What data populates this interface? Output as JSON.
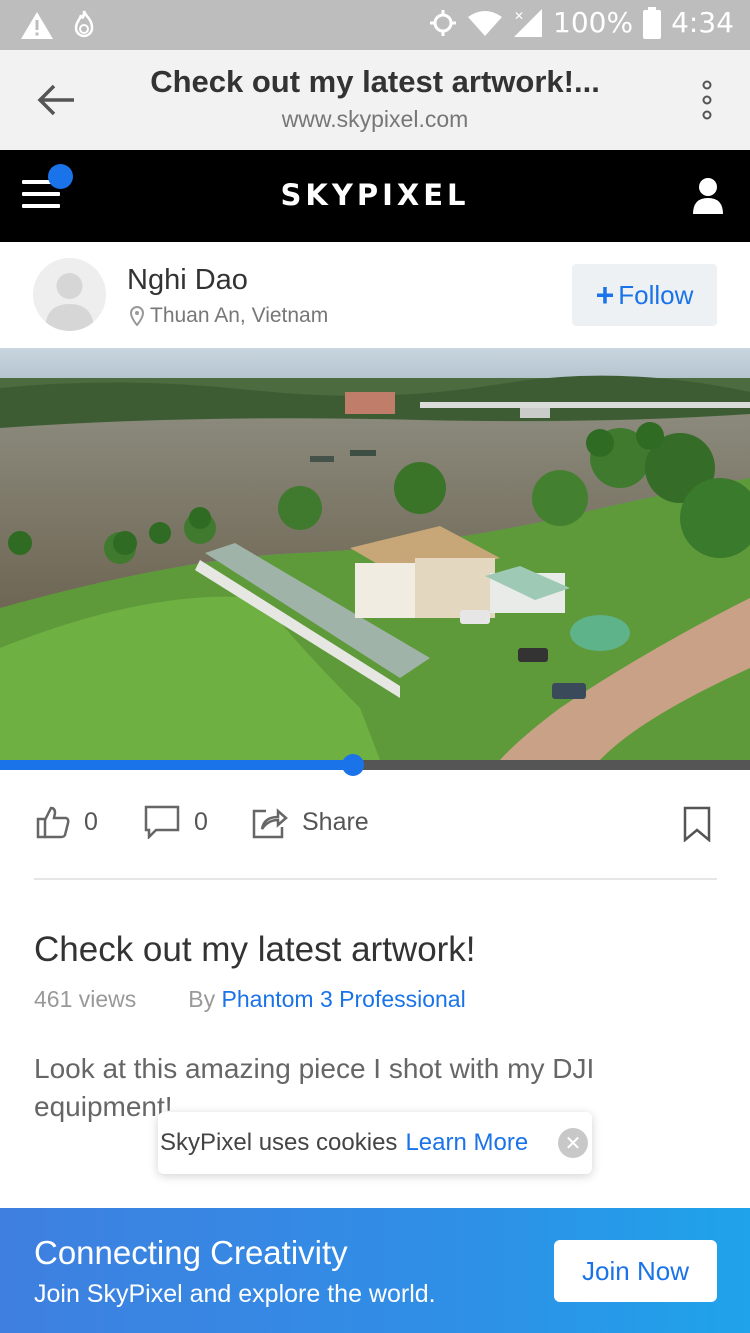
{
  "status_bar": {
    "battery": "100%",
    "time": "4:34",
    "icons": [
      "warning-icon",
      "flame-icon",
      "gps-icon",
      "wifi-icon",
      "signal-icon",
      "battery-icon"
    ]
  },
  "browser": {
    "title": "Check out my latest artwork!...",
    "url": "www.skypixel.com"
  },
  "site_header": {
    "logo": "SKYPIXEL"
  },
  "author": {
    "name": "Nghi Dao",
    "location": "Thuan An, Vietnam",
    "follow_label": "Follow"
  },
  "video": {
    "progress_fraction": 0.47
  },
  "actions": {
    "likes": "0",
    "comments": "0",
    "share_label": "Share"
  },
  "post": {
    "title": "Check out my latest artwork!",
    "views": "461 views",
    "by_label": "By",
    "device": "Phantom 3 Professional",
    "description": "Look at this amazing piece I shot with my DJI equipment!"
  },
  "cookie": {
    "text": "SkyPixel uses cookies",
    "link": "Learn More"
  },
  "banner": {
    "title": "Connecting Creativity",
    "subtitle": "Join SkyPixel and explore the world.",
    "button": "Join Now"
  },
  "colors": {
    "accent": "#1a73e8",
    "header_bg": "#000000",
    "status_bar_bg": "#bdbdbd"
  }
}
